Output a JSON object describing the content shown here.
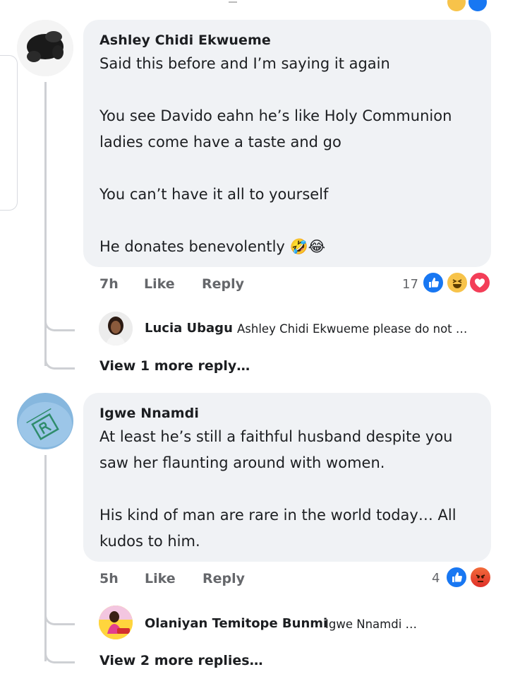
{
  "comments": [
    {
      "author": "Ashley Chidi Ekwueme",
      "text": "Said this before and I’m saying it again\n\nYou see Davido eahn he’s like Holy Communion ladies come have a taste and go\n\nYou can’t have it all to yourself\n\nHe donates benevolently 🤣😂",
      "time": "7h",
      "like_label": "Like",
      "reply_label": "Reply",
      "reaction_count": "17",
      "reactions": [
        "like-icon",
        "haha-icon",
        "love-icon"
      ],
      "reply_preview": {
        "author": "Lucia Ubagu",
        "text": "Ashley Chidi Ekwueme please do not …"
      },
      "more_replies": "View 1 more reply…"
    },
    {
      "author": "Igwe Nnamdi",
      "text": "At least he’s still a faithful husband despite you saw her flaunting around with women.\n\nHis kind of man are rare in the world today… All kudos to him.",
      "time": "5h",
      "like_label": "Like",
      "reply_label": "Reply",
      "reaction_count": "4",
      "reactions": [
        "like-icon",
        "angry-icon"
      ],
      "reply_preview": {
        "author": "Olaniyan Temitope Bunmi",
        "text": "Igwe Nnamdi …"
      },
      "more_replies": "View 2 more replies…"
    }
  ],
  "colors": {
    "bubble": "#f0f2f5",
    "meta": "#65676b",
    "like": "#1877f2",
    "thread": "#ced0d4"
  }
}
